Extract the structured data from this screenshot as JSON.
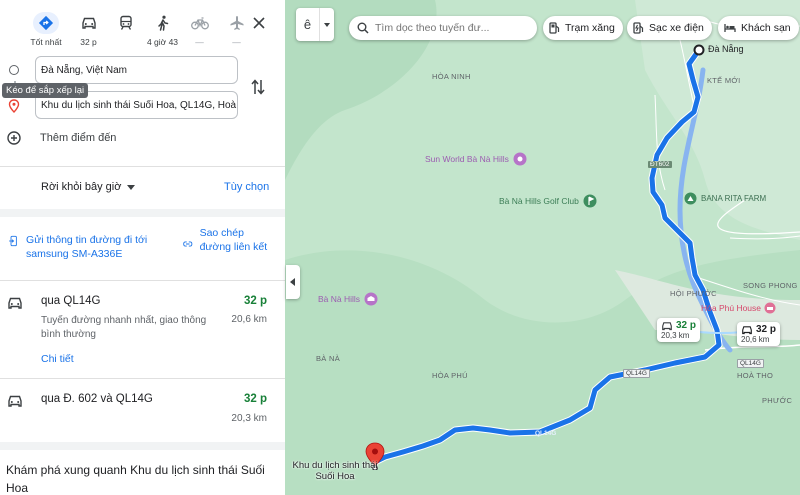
{
  "modes": [
    {
      "icon": "directions-icon",
      "label": "Tốt nhất",
      "selected": true
    },
    {
      "icon": "car-icon",
      "label": "32 p",
      "selected": false
    },
    {
      "icon": "transit-icon",
      "label": "",
      "selected": false
    },
    {
      "icon": "walk-icon",
      "label": "4 giờ 43",
      "selected": false
    },
    {
      "icon": "bike-icon",
      "label": "—",
      "selected": false
    },
    {
      "icon": "flight-icon",
      "label": "—",
      "selected": false
    }
  ],
  "origin": "Đà Nẵng, Việt Nam",
  "destination": "Khu du lịch sinh thái Suối Hoa, QL14G, Hoà",
  "tooltip": "Kéo để sắp xếp lại",
  "add_destination": "Thêm điểm đến",
  "depart_label": "Rời khỏi bây giờ",
  "options_label": "Tùy chọn",
  "send_label": "Gửi thông tin đường đi tới samsung SM-A336E",
  "copy_label": "Sao chép đường liên kết",
  "routes": [
    {
      "name": "qua QL14G",
      "time": "32 p",
      "desc": "Tuyến đường nhanh nhất, giao thông bình thường",
      "dist": "20,6 km",
      "details": "Chi tiết"
    },
    {
      "name": "qua Đ. 602 và QL14G",
      "time": "32 p",
      "dist": "20,3 km"
    }
  ],
  "explore": "Khám phá xung quanh Khu du lịch sinh thái Suối Hoa",
  "map": {
    "search_placeholder": "Tìm dọc theo tuyến đư...",
    "layer_label": "ê",
    "chips": [
      "Trạm xăng",
      "Sạc xe điện",
      "Khách sạn"
    ],
    "labels": {
      "hoa_ninh": "HÒA NINH",
      "ba_na": "BÀ NÀ",
      "hoa_phu": "HÒA PHÚ",
      "hoa_tho": "HOÀ THO",
      "phuoc": "PHƯỚC",
      "song_phong": "SONG PHONG",
      "ke_moi": "KTẾ MỚI",
      "hoi_phuoc": "HỘI PHƯỚC"
    },
    "pois": {
      "sunworld": "Sun World Bà Nà Hills",
      "golf": "Bà Nà Hills Golf Club",
      "rita": "BANA RITA FARM",
      "banahills": "Bà Nà Hills",
      "hoaphu_house": "Hòa Phú House"
    },
    "roads": {
      "r1": "ĐT602",
      "r2": "QL14G",
      "r3": "QL14G",
      "r4": "QL14G"
    },
    "start_label": "Đà Nẵng",
    "end_label": "Khu du lịch sinh thái Suối Hoa",
    "callouts": [
      {
        "time": "32 p",
        "dist": "20,3 km"
      },
      {
        "time": "32 p",
        "dist": "20,6 km"
      }
    ]
  },
  "colors": {
    "route": "#1a73e8",
    "alt_route": "#88b4f0",
    "accent": "#1a73e8",
    "time_green": "#188038",
    "pin": "#ea4335"
  }
}
